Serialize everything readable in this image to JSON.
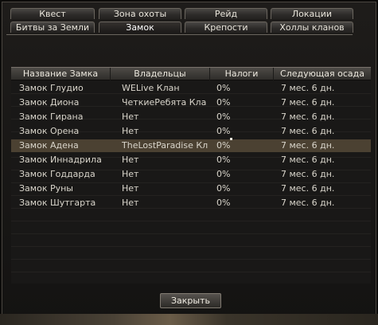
{
  "tabs": {
    "row1": [
      "Квест",
      "Зона охоты",
      "Рейд",
      "Локации"
    ],
    "row2": [
      "Битвы за Земли",
      "Замок",
      "Крепости",
      "Холлы кланов"
    ],
    "active": "Замок"
  },
  "table": {
    "columns": [
      "Название Замка",
      "Владельцы",
      "Налоги",
      "Следующая осада"
    ],
    "rows": [
      [
        "Замок Глудио",
        "WELive Клан",
        "0%",
        "7 мес. 6 дн."
      ],
      [
        "Замок Диона",
        "ЧеткиеРебята Кла",
        "0%",
        "7 мес. 6 дн."
      ],
      [
        "Замок Гирана",
        "Нет",
        "0%",
        "7 мес. 6 дн."
      ],
      [
        "Замок Орена",
        "Нет",
        "0%",
        "7 мес. 6 дн."
      ],
      [
        "Замок Адена",
        "TheLostParadise Кл",
        "0%",
        "7 мес. 6 дн."
      ],
      [
        "Замок Иннадрила",
        "Нет",
        "0%",
        "7 мес. 6 дн."
      ],
      [
        "Замок Годдарда",
        "Нет",
        "0%",
        "7 мес. 6 дн."
      ],
      [
        "Замок Руны",
        "Нет",
        "0%",
        "7 мес. 6 дн."
      ],
      [
        "Замок Шутгарта",
        "Нет",
        "0%",
        "7 мес. 6 дн."
      ]
    ],
    "selected_row": 4
  },
  "close_button": "Закрыть",
  "colors": {
    "selected_row": "#4b4132",
    "header": "#3f3c39"
  }
}
